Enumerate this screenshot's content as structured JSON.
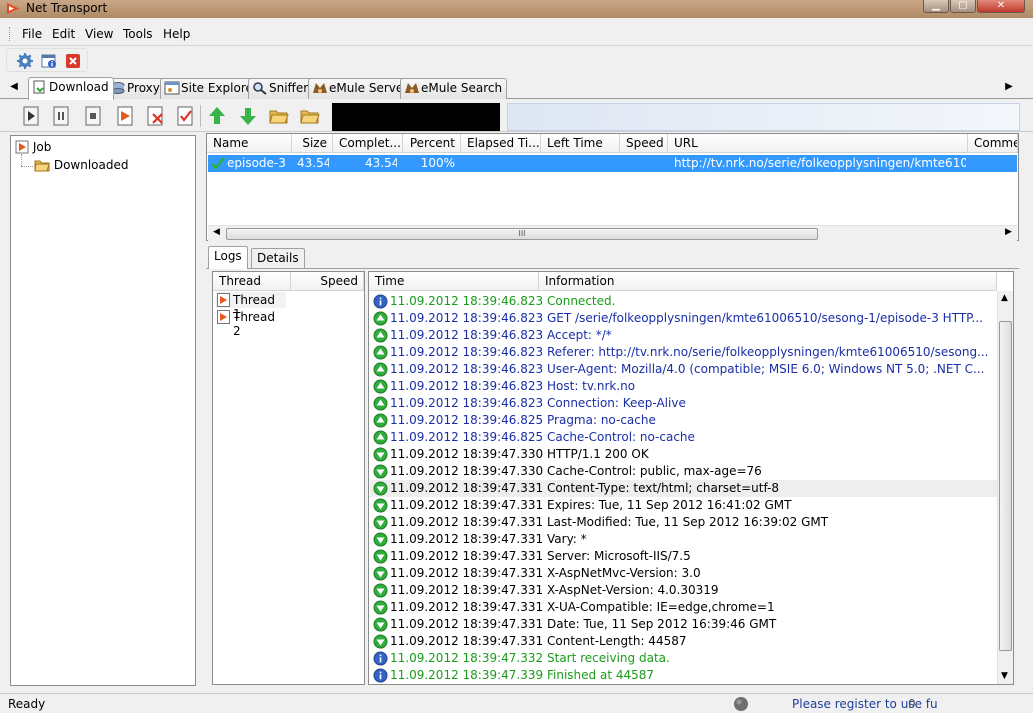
{
  "window": {
    "title": "Net Transport"
  },
  "menu": [
    "File",
    "Edit",
    "View",
    "Tools",
    "Help"
  ],
  "tabs": [
    "Download",
    "Proxy",
    "Site Explorer",
    "Sniffer",
    "eMule Server",
    "eMule Search"
  ],
  "tree": {
    "root": "Job",
    "child": "Downloaded"
  },
  "download_list": {
    "columns": [
      "Name",
      "Size",
      "Complet...",
      "Percent",
      "Elapsed Ti...",
      "Left Time",
      "Speed",
      "URL",
      "Comme"
    ],
    "rows": [
      {
        "name": "episode-3",
        "size": "43.54",
        "completed": "43.54",
        "percent": "100%",
        "elapsed": "",
        "left": "",
        "speed": "",
        "url": "http://tv.nrk.no/serie/folkeopplysningen/kmte61006...",
        "comment": ""
      }
    ]
  },
  "subtabs": [
    "Logs",
    "Details"
  ],
  "threads": {
    "columns": [
      "Thread",
      "Speed"
    ],
    "rows": [
      "Thread 1",
      "Thread 2"
    ]
  },
  "logs": {
    "columns": [
      "Time",
      "Information"
    ],
    "rows": [
      {
        "icon": "info",
        "color": "#1a9b1a",
        "time": "11.09.2012 18:39:46.823",
        "info": "Connected."
      },
      {
        "icon": "up",
        "color": "#1a2ea8",
        "time": "11.09.2012 18:39:46.823",
        "info": "GET /serie/folkeopplysningen/kmte61006510/sesong-1/episode-3 HTTP..."
      },
      {
        "icon": "up",
        "color": "#1a2ea8",
        "time": "11.09.2012 18:39:46.823",
        "info": "Accept: */*"
      },
      {
        "icon": "up",
        "color": "#1a2ea8",
        "time": "11.09.2012 18:39:46.823",
        "info": "Referer: http://tv.nrk.no/serie/folkeopplysningen/kmte61006510/sesong..."
      },
      {
        "icon": "up",
        "color": "#1a2ea8",
        "time": "11.09.2012 18:39:46.823",
        "info": "User-Agent: Mozilla/4.0 (compatible; MSIE 6.0; Windows NT 5.0; .NET C..."
      },
      {
        "icon": "up",
        "color": "#1a2ea8",
        "time": "11.09.2012 18:39:46.823",
        "info": "Host: tv.nrk.no"
      },
      {
        "icon": "up",
        "color": "#1a2ea8",
        "time": "11.09.2012 18:39:46.823",
        "info": "Connection: Keep-Alive"
      },
      {
        "icon": "up",
        "color": "#1a2ea8",
        "time": "11.09.2012 18:39:46.825",
        "info": "Pragma: no-cache"
      },
      {
        "icon": "up",
        "color": "#1a2ea8",
        "time": "11.09.2012 18:39:46.825",
        "info": "Cache-Control: no-cache"
      },
      {
        "icon": "down",
        "color": "#000000",
        "time": "11.09.2012 18:39:47.330",
        "info": "HTTP/1.1 200 OK"
      },
      {
        "icon": "down",
        "color": "#000000",
        "time": "11.09.2012 18:39:47.330",
        "info": "Cache-Control: public, max-age=76"
      },
      {
        "icon": "down",
        "color": "#000000",
        "time": "11.09.2012 18:39:47.331",
        "info": "Content-Type: text/html; charset=utf-8"
      },
      {
        "icon": "down",
        "color": "#000000",
        "time": "11.09.2012 18:39:47.331",
        "info": "Expires: Tue, 11 Sep 2012 16:41:02 GMT"
      },
      {
        "icon": "down",
        "color": "#000000",
        "time": "11.09.2012 18:39:47.331",
        "info": "Last-Modified: Tue, 11 Sep 2012 16:39:02 GMT"
      },
      {
        "icon": "down",
        "color": "#000000",
        "time": "11.09.2012 18:39:47.331",
        "info": "Vary: *"
      },
      {
        "icon": "down",
        "color": "#000000",
        "time": "11.09.2012 18:39:47.331",
        "info": "Server: Microsoft-IIS/7.5"
      },
      {
        "icon": "down",
        "color": "#000000",
        "time": "11.09.2012 18:39:47.331",
        "info": "X-AspNetMvc-Version: 3.0"
      },
      {
        "icon": "down",
        "color": "#000000",
        "time": "11.09.2012 18:39:47.331",
        "info": "X-AspNet-Version: 4.0.30319"
      },
      {
        "icon": "down",
        "color": "#000000",
        "time": "11.09.2012 18:39:47.331",
        "info": "X-UA-Compatible: IE=edge,chrome=1"
      },
      {
        "icon": "down",
        "color": "#000000",
        "time": "11.09.2012 18:39:47.331",
        "info": "Date: Tue, 11 Sep 2012 16:39:46 GMT"
      },
      {
        "icon": "down",
        "color": "#000000",
        "time": "11.09.2012 18:39:47.331",
        "info": "Content-Length: 44587"
      },
      {
        "icon": "info",
        "color": "#1a9b1a",
        "time": "11.09.2012 18:39:47.332",
        "info": "Start receiving data."
      },
      {
        "icon": "info",
        "color": "#1a9b1a",
        "time": "11.09.2012 18:39:47.339",
        "info": "Finished at 44587"
      }
    ]
  },
  "status": {
    "left": "Ready",
    "register": "Please register to use fu",
    "count": "0"
  },
  "colors": {
    "selection": "#3399ff",
    "info_green": "#1a9b1a",
    "request_blue": "#1a2ea8",
    "icon_green": "#2fae3a",
    "icon_blue": "#3463c7"
  }
}
